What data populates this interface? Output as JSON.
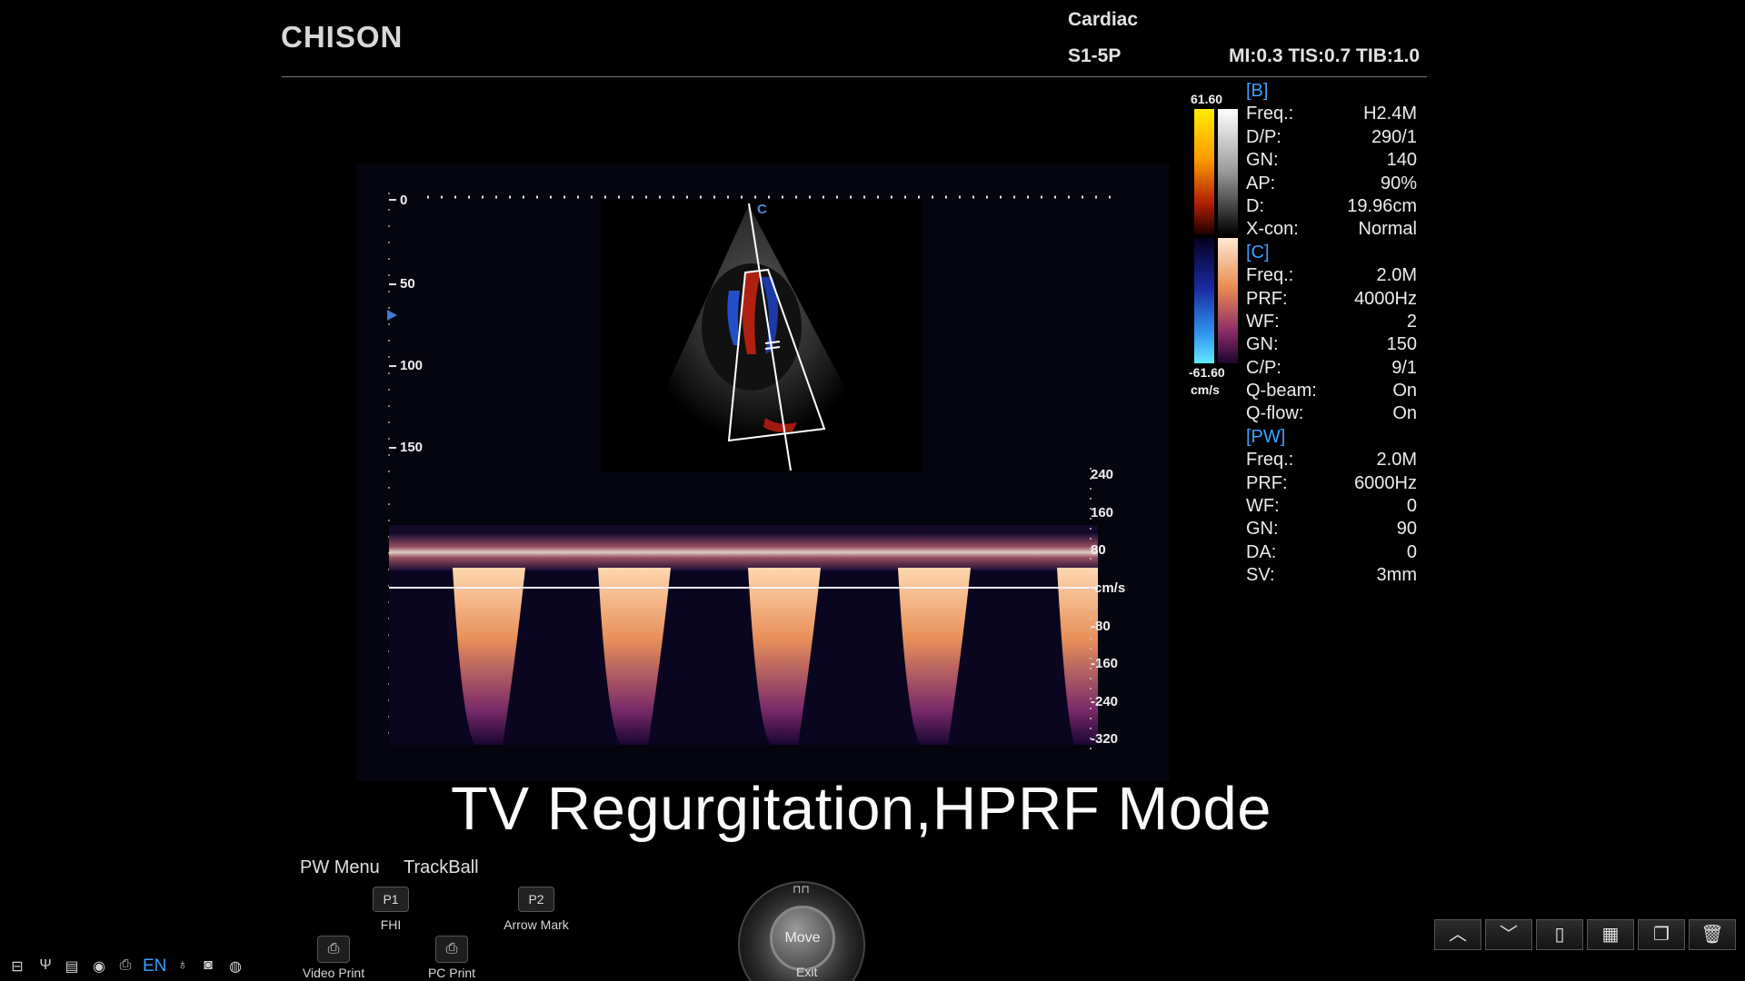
{
  "header": {
    "brand": "CHISON",
    "exam": "Cardiac",
    "probe": "S1-5P",
    "safety": "MI:0.3 TIS:0.7 TIB:1.0"
  },
  "depth_scale": {
    "labels": [
      "0",
      "50",
      "100",
      "150"
    ]
  },
  "velocity_scale": {
    "labels": [
      "240",
      "160",
      "80",
      "cm/s",
      "-80",
      "-160",
      "-240",
      "-320"
    ]
  },
  "sector_label": "C",
  "color_bar": {
    "max": "61.60",
    "min": "-61.60",
    "unit": "cm/s"
  },
  "params": {
    "b_title": "[B]",
    "b": [
      {
        "k": "Freq.:",
        "v": "H2.4M"
      },
      {
        "k": "D/P:",
        "v": "290/1"
      },
      {
        "k": "GN:",
        "v": "140"
      },
      {
        "k": "AP:",
        "v": "90%"
      },
      {
        "k": "D:",
        "v": "19.96cm"
      },
      {
        "k": "X-con:",
        "v": "Normal"
      }
    ],
    "c_title": "[C]",
    "c": [
      {
        "k": "Freq.:",
        "v": "2.0M"
      },
      {
        "k": "PRF:",
        "v": "4000Hz"
      },
      {
        "k": "WF:",
        "v": "2"
      },
      {
        "k": "GN:",
        "v": "150"
      },
      {
        "k": "C/P:",
        "v": "9/1"
      },
      {
        "k": "Q-beam:",
        "v": "On"
      },
      {
        "k": "Q-flow:",
        "v": "On"
      }
    ],
    "pw_title": "[PW]",
    "pw": [
      {
        "k": "Freq.:",
        "v": "2.0M"
      },
      {
        "k": "PRF:",
        "v": "6000Hz"
      },
      {
        "k": "WF:",
        "v": "0"
      },
      {
        "k": "GN:",
        "v": "90"
      },
      {
        "k": "DA:",
        "v": "0"
      },
      {
        "k": "SV:",
        "v": "3mm"
      }
    ]
  },
  "caption": "TV Regurgitation,HPRF Mode",
  "bottom_menu": {
    "menu_title": "PW Menu",
    "trackball_title": "TrackBall",
    "p1_key": "P1",
    "p1_label": "FHI",
    "p2_key": "P2",
    "p2_label": "Arrow Mark",
    "video_print": "Video Print",
    "pc_print": "PC Print",
    "trackball_center": "Move",
    "trackball_exit": "Exit"
  },
  "status_bar": {
    "language": "EN",
    "icons": [
      "network-icon",
      "usb-icon",
      "storage-icon",
      "mouse-icon",
      "printer-icon",
      "language-indicator",
      "probe-icon",
      "dvr-icon",
      "globe-icon"
    ]
  },
  "nav_buttons": [
    {
      "name": "page-up-icon",
      "glyph": "︿"
    },
    {
      "name": "page-down-icon",
      "glyph": "﹀"
    },
    {
      "name": "single-layout-icon",
      "glyph": "▯"
    },
    {
      "name": "quad-layout-icon",
      "glyph": "▦"
    },
    {
      "name": "review-icon",
      "glyph": "❐"
    },
    {
      "name": "delete-icon",
      "glyph": "🗑"
    }
  ]
}
